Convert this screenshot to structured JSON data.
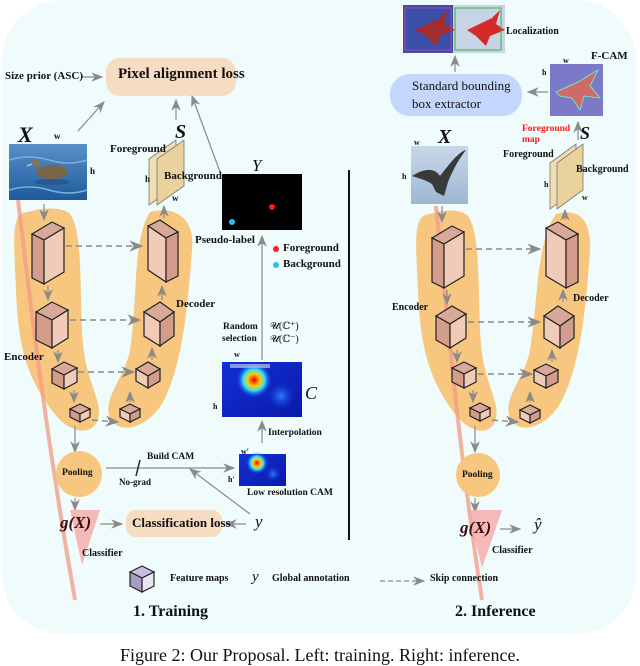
{
  "training": {
    "section_title": "1. Training",
    "size_prior": "Size prior (ASC)",
    "pixel_alignment_loss": "Pixel alignment loss",
    "input_symbol": "X",
    "dim_w": "w",
    "dim_h": "h",
    "dim_w_prime": "w′",
    "dim_h_prime": "h′",
    "output_symbol": "S",
    "foreground": "Foreground",
    "background": "Background",
    "pseudo_label_symbol": "Y",
    "pseudo_label": "Pseudo-label",
    "legend_foreground": "Foreground",
    "legend_background": "Background",
    "encoder": "Encoder",
    "decoder": "Decoder",
    "random_selection_line1": "Random",
    "random_selection_line2": "selection",
    "sampling_pos": "𝓤(ℂ⁺)",
    "sampling_neg": "𝓤(ℂ⁻)",
    "cam_symbol": "C",
    "interpolation": "Interpolation",
    "pooling": "Pooling",
    "build_cam": "Build CAM",
    "no_grad": "No-grad",
    "low_res_cam": "Low resolution CAM",
    "classifier_output": "g(X)",
    "classification_loss": "Classification loss",
    "global_label_symbol": "y",
    "classifier": "Classifier"
  },
  "inference": {
    "section_title": "2. Inference",
    "localization": "Localization",
    "fcam": "F-CAM",
    "bbox_extractor_line1": "Standard bounding",
    "bbox_extractor_line2": "box extractor",
    "foreground_map_line1": "Foreground",
    "foreground_map_line2": "map",
    "input_symbol": "X",
    "output_symbol": "S",
    "foreground": "Foreground",
    "background": "Background",
    "dim_w": "w",
    "dim_h": "h",
    "encoder": "Encoder",
    "decoder": "Decoder",
    "pooling": "Pooling",
    "classifier_output": "g(X)",
    "prediction": "ŷ",
    "classifier": "Classifier"
  },
  "legend": {
    "feature_maps": "Feature maps",
    "global_symbol": "y",
    "global_annotation": "Global annotation",
    "skip_connection": "Skip connection"
  },
  "caption": "Figure 2: Our Proposal. Left: training. Right: inference.",
  "colors": {
    "panel_bg": "#effcfb",
    "loss_box": "#f7dcc4",
    "bbox_box": "#c4d6fb",
    "encoder_blob": "#f7c77f",
    "feature_map": "#e8b8a4",
    "map_sheet": "#f1deb0",
    "foreground_dot": "#ff1a1a",
    "background_dot": "#29c3f0",
    "classifier_arrow": "#f6a8a8",
    "foreground_map_text": "#ff1a1a"
  }
}
